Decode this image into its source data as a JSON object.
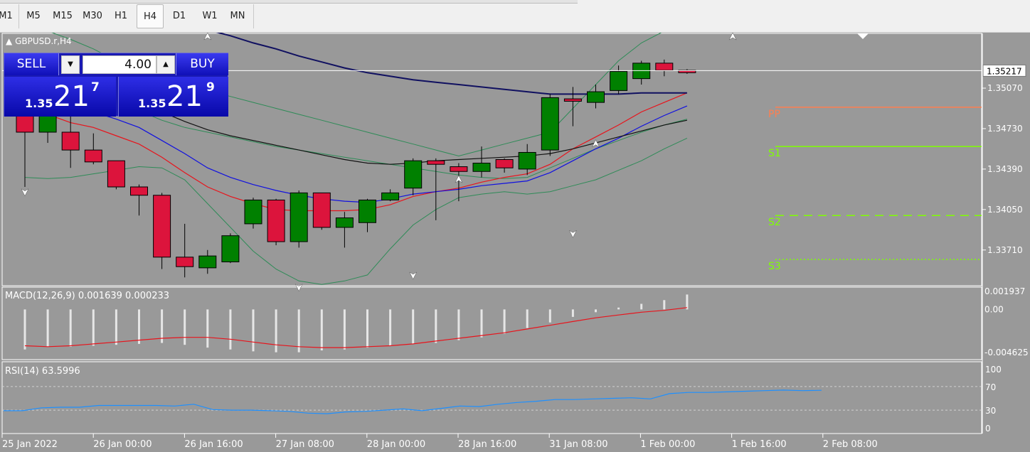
{
  "toolbar": {
    "timeframes": [
      "M1",
      "M5",
      "M15",
      "M30",
      "H1",
      "H4",
      "D1",
      "W1",
      "MN"
    ],
    "active": "H4"
  },
  "symbol": "GBPUSD.r,H4",
  "trade_panel": {
    "sell_label": "SELL",
    "buy_label": "BUY",
    "volume": "4.00",
    "sell_prefix": "1.35",
    "sell_big": "21",
    "sell_sup": "7",
    "buy_prefix": "1.35",
    "buy_big": "21",
    "buy_sup": "9"
  },
  "colors": {
    "background": "#999999",
    "bull": "#008000",
    "bear": "#dc143c",
    "ma_red": "#e8141c",
    "ma_blue": "#1010e0",
    "ma_black": "#111111",
    "ma_navy": "#101060",
    "bands": "#2e8b57",
    "pivot": "#ff7f50",
    "support": "#7fff00",
    "macd_signal": "#e8141c",
    "macd_hist": "#e6e6e6",
    "rsi": "#1e90ff"
  },
  "chart_data": [
    {
      "type": "candlestick",
      "title": "GBPUSD.r,H4",
      "x_labels": [
        "25 Jan 2022",
        "26 Jan 00:00",
        "26 Jan 16:00",
        "27 Jan 08:00",
        "28 Jan 00:00",
        "28 Jan 16:00",
        "31 Jan 08:00",
        "1 Feb 00:00",
        "1 Feb 16:00",
        "2 Feb 08:00"
      ],
      "y_ticks": [
        1.3371,
        1.3405,
        1.3439,
        1.3473,
        1.3507
      ],
      "ylim": [
        1.3341,
        1.3553
      ],
      "current_price": 1.35217,
      "candles": [
        {
          "o": 1.3486,
          "h": 1.3532,
          "l": 1.3424,
          "c": 1.347
        },
        {
          "o": 1.347,
          "h": 1.3526,
          "l": 1.3461,
          "c": 1.3489
        },
        {
          "o": 1.347,
          "h": 1.3497,
          "l": 1.344,
          "c": 1.3455
        },
        {
          "o": 1.3455,
          "h": 1.3469,
          "l": 1.3443,
          "c": 1.3445
        },
        {
          "o": 1.3446,
          "h": 1.3446,
          "l": 1.3422,
          "c": 1.3424
        },
        {
          "o": 1.3424,
          "h": 1.3426,
          "l": 1.34,
          "c": 1.3417
        },
        {
          "o": 1.3417,
          "h": 1.3419,
          "l": 1.3355,
          "c": 1.3365
        },
        {
          "o": 1.3365,
          "h": 1.3393,
          "l": 1.3348,
          "c": 1.3357
        },
        {
          "o": 1.3356,
          "h": 1.3371,
          "l": 1.3351,
          "c": 1.3366
        },
        {
          "o": 1.3361,
          "h": 1.3385,
          "l": 1.336,
          "c": 1.3383
        },
        {
          "o": 1.3393,
          "h": 1.3415,
          "l": 1.3389,
          "c": 1.3413
        },
        {
          "o": 1.3413,
          "h": 1.3414,
          "l": 1.3375,
          "c": 1.3378
        },
        {
          "o": 1.3378,
          "h": 1.3421,
          "l": 1.3373,
          "c": 1.3419
        },
        {
          "o": 1.3419,
          "h": 1.3419,
          "l": 1.3388,
          "c": 1.339
        },
        {
          "o": 1.339,
          "h": 1.3403,
          "l": 1.3373,
          "c": 1.3398
        },
        {
          "o": 1.3394,
          "h": 1.3414,
          "l": 1.3386,
          "c": 1.3413
        },
        {
          "o": 1.3413,
          "h": 1.3422,
          "l": 1.3412,
          "c": 1.3419
        },
        {
          "o": 1.3423,
          "h": 1.3448,
          "l": 1.3417,
          "c": 1.3446
        },
        {
          "o": 1.3446,
          "h": 1.3448,
          "l": 1.3396,
          "c": 1.3443
        },
        {
          "o": 1.3441,
          "h": 1.3444,
          "l": 1.3412,
          "c": 1.3437
        },
        {
          "o": 1.3437,
          "h": 1.3458,
          "l": 1.3432,
          "c": 1.3444
        },
        {
          "o": 1.3447,
          "h": 1.3448,
          "l": 1.3436,
          "c": 1.344
        },
        {
          "o": 1.3439,
          "h": 1.346,
          "l": 1.3434,
          "c": 1.3453
        },
        {
          "o": 1.3455,
          "h": 1.3502,
          "l": 1.345,
          "c": 1.3499
        },
        {
          "o": 1.3498,
          "h": 1.3508,
          "l": 1.3475,
          "c": 1.3496
        },
        {
          "o": 1.3495,
          "h": 1.351,
          "l": 1.349,
          "c": 1.3504
        },
        {
          "o": 1.3505,
          "h": 1.3526,
          "l": 1.3502,
          "c": 1.3521
        },
        {
          "o": 1.3515,
          "h": 1.353,
          "l": 1.351,
          "c": 1.3528
        },
        {
          "o": 1.3528,
          "h": 1.3531,
          "l": 1.3517,
          "c": 1.3522
        },
        {
          "o": 1.3522,
          "h": 1.3523,
          "l": 1.3519,
          "c": 1.352
        }
      ],
      "moving_averages": [
        {
          "color_key": "ma_red",
          "values": [
            1.3487,
            1.3485,
            1.3478,
            1.3474,
            1.3467,
            1.346,
            1.3449,
            1.3436,
            1.3424,
            1.3416,
            1.341,
            1.3405,
            1.3404,
            1.3404,
            1.3404,
            1.3405,
            1.3409,
            1.3416,
            1.342,
            1.3423,
            1.3428,
            1.3432,
            1.3435,
            1.3443,
            1.3456,
            1.3466,
            1.3476,
            1.3487,
            1.3495,
            1.3503
          ]
        },
        {
          "color_key": "ma_blue",
          "values": [
            1.3501,
            1.3497,
            1.3491,
            1.3487,
            1.3481,
            1.3474,
            1.3463,
            1.3452,
            1.344,
            1.3432,
            1.3426,
            1.3421,
            1.3417,
            1.3414,
            1.3412,
            1.3411,
            1.3414,
            1.3418,
            1.342,
            1.3422,
            1.3425,
            1.3427,
            1.3429,
            1.3436,
            1.3446,
            1.3456,
            1.3465,
            1.3475,
            1.3484,
            1.3492
          ]
        },
        {
          "color_key": "ma_black",
          "values": [
            1.352,
            1.3518,
            1.3514,
            1.3509,
            1.3503,
            1.3496,
            1.3487,
            1.3479,
            1.3472,
            1.3467,
            1.3463,
            1.3459,
            1.3455,
            1.3451,
            1.3447,
            1.3444,
            1.3443,
            1.3444,
            1.3446,
            1.3447,
            1.3448,
            1.3449,
            1.345,
            1.3452,
            1.3456,
            1.3461,
            1.3466,
            1.3471,
            1.3476,
            1.348
          ]
        },
        {
          "color_key": "ma_navy",
          "values": [
            1.358,
            1.3578,
            1.3576,
            1.3574,
            1.3572,
            1.357,
            1.3566,
            1.3561,
            1.3556,
            1.3551,
            1.3545,
            1.354,
            1.3534,
            1.3529,
            1.3524,
            1.352,
            1.3517,
            1.3514,
            1.3512,
            1.351,
            1.3508,
            1.3506,
            1.3504,
            1.3502,
            1.3502,
            1.3502,
            1.3502,
            1.3503,
            1.3503,
            1.3503
          ]
        }
      ],
      "bands": [
        {
          "color_key": "bands",
          "values": [
            1.356,
            1.3555,
            1.3548,
            1.354,
            1.353,
            1.352,
            1.3512,
            1.3508,
            1.3505,
            1.35,
            1.3495,
            1.349,
            1.3485,
            1.348,
            1.3475,
            1.347,
            1.3465,
            1.346,
            1.3455,
            1.345,
            1.3455,
            1.346,
            1.3465,
            1.347,
            1.349,
            1.351,
            1.353,
            1.3545,
            1.3555,
            1.356
          ]
        },
        {
          "color_key": "bands",
          "values": [
            1.351,
            1.3507,
            1.3504,
            1.35,
            1.3494,
            1.3488,
            1.348,
            1.3474,
            1.347,
            1.3466,
            1.3462,
            1.3458,
            1.3455,
            1.3452,
            1.3449,
            1.3446,
            1.3443,
            1.344,
            1.3437,
            1.3434,
            1.3432,
            1.3431,
            1.3432,
            1.344,
            1.3448,
            1.3456,
            1.3463,
            1.347,
            1.3476,
            1.3481
          ]
        },
        {
          "color_key": "bands",
          "values": [
            1.3432,
            1.3431,
            1.3432,
            1.3435,
            1.3438,
            1.3441,
            1.344,
            1.343,
            1.341,
            1.339,
            1.337,
            1.3355,
            1.3345,
            1.3342,
            1.3345,
            1.335,
            1.3372,
            1.3392,
            1.3405,
            1.3415,
            1.3418,
            1.342,
            1.3418,
            1.342,
            1.3425,
            1.343,
            1.3438,
            1.3446,
            1.3456,
            1.3465
          ]
        }
      ],
      "levels": [
        {
          "label": "PP",
          "value": 1.3491,
          "style": "solid",
          "color_key": "pivot"
        },
        {
          "label": "S1",
          "value": 1.3458,
          "style": "solid",
          "color_key": "support"
        },
        {
          "label": "S2",
          "value": 1.34,
          "style": "dashed",
          "color_key": "support"
        },
        {
          "label": "S3",
          "value": 1.3363,
          "style": "dotted",
          "color_key": "support"
        }
      ],
      "fractals_up": [
        {
          "i": 8,
          "v": 1.355
        },
        {
          "i": 19,
          "v": 1.343
        },
        {
          "i": 25,
          "v": 1.346
        },
        {
          "i": 31,
          "v": 1.355
        }
      ],
      "fractals_down": [
        {
          "i": 0,
          "v": 1.342
        },
        {
          "i": 12,
          "v": 1.334
        },
        {
          "i": 17,
          "v": 1.335
        },
        {
          "i": 24,
          "v": 1.3385
        }
      ]
    },
    {
      "type": "bar",
      "title": "MACD(12,26,9) 0.001639 0.000233",
      "y_ticks": [
        "0.001937",
        "0.00",
        "-0.004625"
      ],
      "ylim": [
        -0.004625,
        0.001937
      ],
      "histogram": [
        -0.0043,
        -0.004,
        -0.004,
        -0.0039,
        -0.0038,
        -0.0037,
        -0.0036,
        -0.0038,
        -0.0041,
        -0.0043,
        -0.0045,
        -0.0046,
        -0.0046,
        -0.0044,
        -0.0043,
        -0.0041,
        -0.0039,
        -0.0037,
        -0.0036,
        -0.0033,
        -0.003,
        -0.0026,
        -0.002,
        -0.0014,
        -0.0008,
        -0.0003,
        0.0002,
        0.0006,
        0.001,
        0.0016
      ],
      "signal": [
        -0.0039,
        -0.004,
        -0.0039,
        -0.0037,
        -0.0035,
        -0.0033,
        -0.0031,
        -0.003,
        -0.003,
        -0.0032,
        -0.0035,
        -0.0038,
        -0.004,
        -0.0041,
        -0.0041,
        -0.004,
        -0.0039,
        -0.0037,
        -0.0034,
        -0.0031,
        -0.0028,
        -0.0025,
        -0.0021,
        -0.0017,
        -0.0013,
        -0.0009,
        -0.0006,
        -0.0003,
        -0.0001,
        0.0002
      ]
    },
    {
      "type": "line",
      "title": "RSI(14) 63.5996",
      "y_ticks": [
        100,
        70,
        30,
        0
      ],
      "ylim": [
        0,
        100
      ],
      "levels": [
        70,
        30
      ],
      "values": [
        29,
        29,
        34,
        35,
        35,
        38,
        38,
        38,
        38,
        37,
        40,
        31,
        30,
        30,
        29,
        28,
        25,
        24,
        27,
        28,
        30,
        32,
        29,
        33,
        37,
        36,
        40,
        43,
        45,
        48,
        48,
        49,
        50,
        51,
        49,
        58,
        60,
        60,
        61,
        62,
        63,
        64,
        63,
        63.6
      ]
    }
  ]
}
